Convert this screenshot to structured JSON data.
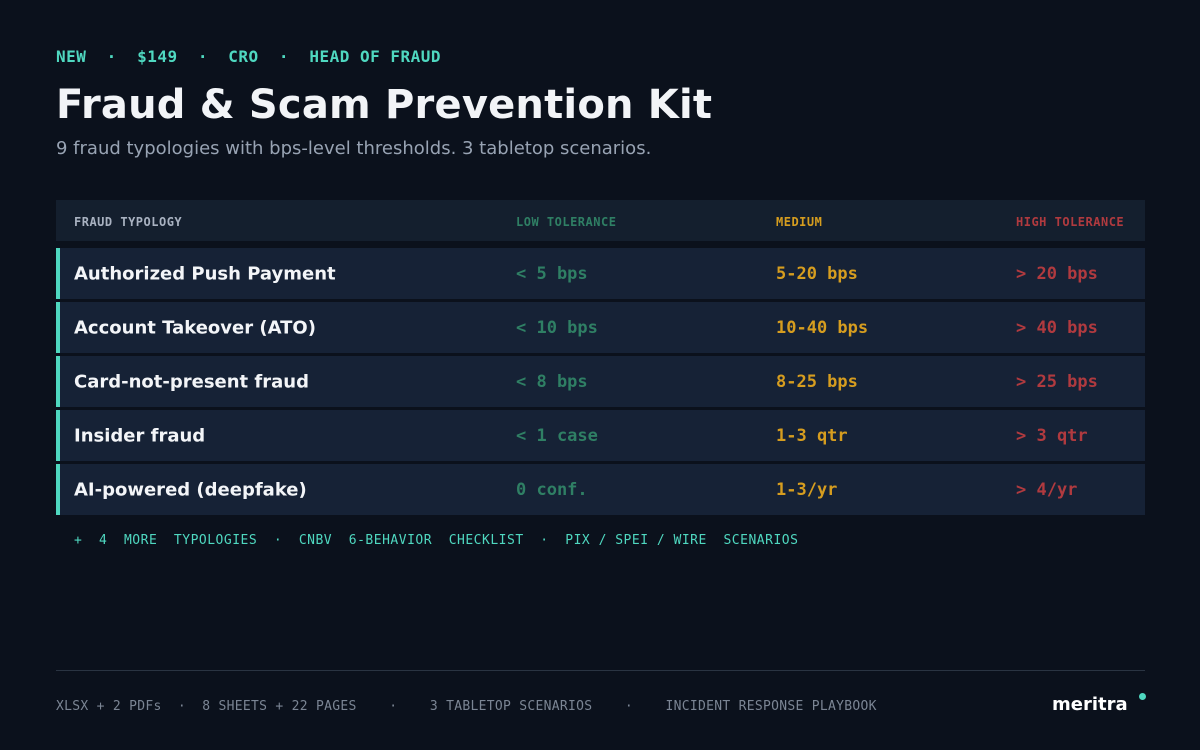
{
  "header": {
    "eyebrow": "NEW  ·  $149  ·  CRO  ·  HEAD OF FRAUD",
    "title": "Fraud & Scam Prevention Kit",
    "subtitle": "9 fraud typologies with bps-level thresholds. 3 tabletop scenarios."
  },
  "table": {
    "columns": [
      "FRAUD TYPOLOGY",
      "LOW TOLERANCE",
      "MEDIUM",
      "HIGH TOLERANCE"
    ],
    "rows": [
      {
        "name": "Authorized Push Payment",
        "low": "< 5 bps",
        "medium": "5-20 bps",
        "high": "> 20 bps"
      },
      {
        "name": "Account Takeover (ATO)",
        "low": "< 10 bps",
        "medium": "10-40 bps",
        "high": "> 40 bps"
      },
      {
        "name": "Card-not-present fraud",
        "low": "< 8 bps",
        "medium": "8-25 bps",
        "high": "> 25 bps"
      },
      {
        "name": "Insider fraud",
        "low": "< 1 case",
        "medium": "1-3 qtr",
        "high": "> 3 qtr"
      },
      {
        "name": "AI-powered (deepfake)",
        "low": "0 conf.",
        "medium": "1-3/yr",
        "high": "> 4/yr"
      }
    ]
  },
  "more_line": "+  4  MORE  TYPOLOGIES  ·  CNBV  6-BEHAVIOR  CHECKLIST  ·  PIX / SPEI / WIRE  SCENARIOS",
  "footer": {
    "meta": "XLSX + 2 PDFs  ·  8 SHEETS + 22 PAGES    ·    3 TABLETOP SCENARIOS    ·    INCIDENT RESPONSE PLAYBOOK",
    "brand": "meritra"
  },
  "colors": {
    "background": "#0b111c",
    "accent": "#4fd8c0",
    "low": "#2f7f64",
    "medium": "#d69d1f",
    "high": "#b03a3f"
  }
}
